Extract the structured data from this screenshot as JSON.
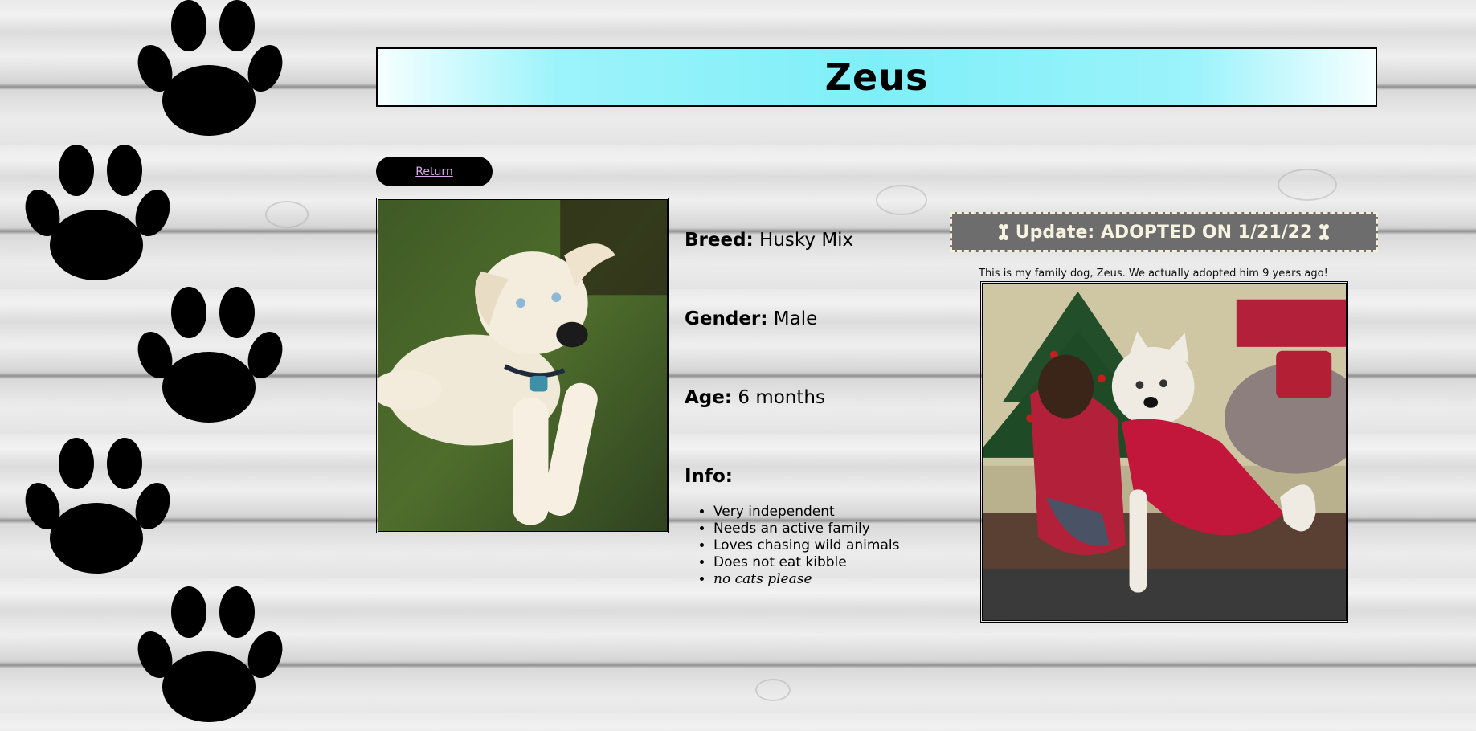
{
  "page": {
    "title": "Zeus",
    "return_label": "Return"
  },
  "pet": {
    "breed_label": "Breed:",
    "breed_value": "Husky Mix",
    "gender_label": "Gender:",
    "gender_value": "Male",
    "age_label": "Age:",
    "age_value": "6 months",
    "info_label": "Info:",
    "info_items": [
      "Very independent",
      "Needs an active family",
      "Loves chasing wild animals",
      "Does not eat kibble",
      "no cats please"
    ]
  },
  "update": {
    "text": "Update: ADOPTED ON 1/21/22",
    "icon_left": "bone-icon",
    "icon_right": "bone-icon",
    "caption": "This is my family dog, Zeus. We actually adopted him 9 years ago!"
  },
  "colors": {
    "header_accent": "#7eeff8",
    "update_bg": "#6d6d6d",
    "return_bg": "#000000",
    "return_link": "#d8a8e8"
  }
}
